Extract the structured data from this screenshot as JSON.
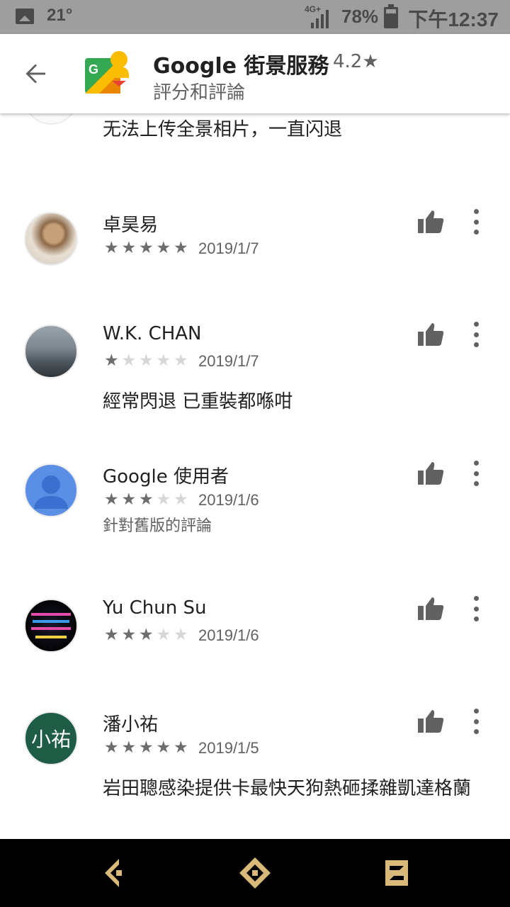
{
  "status_bar": {
    "temperature": "21°",
    "network": "4G+",
    "battery": "78%",
    "time": "下午12:37"
  },
  "header": {
    "title": "Google 街景服務",
    "rating": "4.2★",
    "subtitle": "評分和評論",
    "back_icon": "arrow-left-icon",
    "logo_icon": "street-view-logo"
  },
  "partial_review": {
    "text": "无法上传全景相片，一直闪退"
  },
  "reviews": [
    {
      "name": "卓昊易",
      "stars": 5,
      "stars_text": "★★★★★",
      "date": "2019/1/7",
      "note": "",
      "text": ""
    },
    {
      "name": "W.K. CHAN",
      "stars": 1,
      "stars_text": "★☆☆☆☆",
      "date": "2019/1/7",
      "note": "",
      "text": "經常閃退 已重裝都喺咁"
    },
    {
      "name": "Google 使用者",
      "stars": 3,
      "stars_text": "★★★☆☆",
      "date": "2019/1/6",
      "note": "針對舊版的評論",
      "text": ""
    },
    {
      "name": "Yu Chun Su",
      "stars": 3,
      "stars_text": "★★★☆☆",
      "date": "2019/1/6",
      "note": "",
      "text": ""
    },
    {
      "name": "潘小祐",
      "avatar_text": "小祐",
      "stars": 5,
      "stars_text": "★★★★★",
      "date": "2019/1/5",
      "note": "",
      "text": "岩田聰感染提供卡最快天狗熱砸揉雜凱達格蘭"
    }
  ],
  "icons": {
    "like": "thumbs-up-icon",
    "more": "more-vertical-icon"
  },
  "colors": {
    "status_bar": "#9e9e9e",
    "nav_bar": "#000000",
    "nav_icon": "#d8b97a",
    "avatar_green": "#1e5c46",
    "avatar_blue": "#5b8fe6"
  }
}
